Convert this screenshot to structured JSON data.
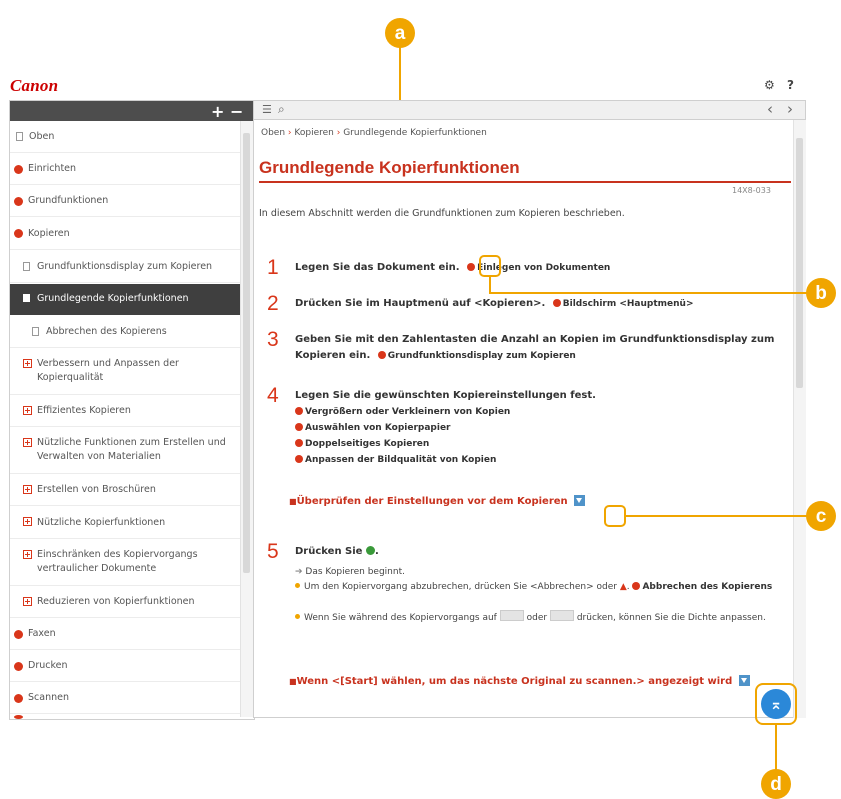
{
  "callouts": [
    "a",
    "b",
    "c",
    "d"
  ],
  "header": {
    "logo": "Canon",
    "gear_icon": "⚙",
    "help_label": "?"
  },
  "sidebar": {
    "expand_all": "+",
    "collapse_all": "−",
    "items": [
      {
        "label": "Oben",
        "icon": "doc-icon"
      },
      {
        "label": "Einrichten",
        "icon": "red-circle-icon"
      },
      {
        "label": "Grundfunktionen",
        "icon": "red-circle-icon"
      },
      {
        "label": "Kopieren",
        "icon": "red-circle-icon"
      },
      {
        "label": "Grundfunktionsdisplay zum Kopieren",
        "icon": "doc-icon"
      },
      {
        "label": "Grundlegende Kopierfunktionen",
        "icon": "doc-icon",
        "active": true
      },
      {
        "label": "Abbrechen des Kopierens",
        "icon": "doc-icon"
      },
      {
        "label": "Verbessern und Anpassen der Kopierqualität",
        "icon": "plus-icon"
      },
      {
        "label": "Effizientes Kopieren",
        "icon": "plus-icon"
      },
      {
        "label": "Nützliche Funktionen zum Erstellen und Verwalten von Materialien",
        "icon": "plus-icon"
      },
      {
        "label": "Erstellen von Broschüren",
        "icon": "plus-icon"
      },
      {
        "label": "Nützliche Kopierfunktionen",
        "icon": "plus-icon"
      },
      {
        "label": "Einschränken des Kopiervorgangs vertraulicher Dokumente",
        "icon": "plus-icon"
      },
      {
        "label": "Reduzieren von Kopierfunktionen",
        "icon": "plus-icon"
      },
      {
        "label": "Faxen",
        "icon": "red-circle-icon"
      },
      {
        "label": "Drucken",
        "icon": "red-circle-icon"
      },
      {
        "label": "Scannen",
        "icon": "red-circle-icon"
      }
    ]
  },
  "toolbar": {
    "toc_icon": "☰",
    "search_icon": "⌕",
    "prev": "‹",
    "next": "›"
  },
  "breadcrumb": [
    "Oben",
    "Kopieren",
    "Grundlegende Kopierfunktionen"
  ],
  "page": {
    "title": "Grundlegende Kopierfunktionen",
    "doc_id": "14X8-033",
    "intro": "In diesem Abschnitt werden die Grundfunktionen zum Kopieren beschrieben.",
    "steps": [
      {
        "num": "1",
        "text": "Legen Sie das Dokument ein.",
        "links": [
          "Einlegen von Dokumenten"
        ]
      },
      {
        "num": "2",
        "text": "Drücken Sie im Hauptmenü auf <Kopieren>.",
        "links": [
          "Bildschirm <Hauptmenü>"
        ]
      },
      {
        "num": "3",
        "text": "Geben Sie mit den Zahlentasten die Anzahl an Kopien im Grundfunktionsdisplay zum Kopieren ein.",
        "links": [
          "Grundfunktionsdisplay zum Kopieren"
        ]
      },
      {
        "num": "4",
        "text": "Legen Sie die gewünschten Kopiereinstellungen fest.",
        "links": [
          "Vergrößern oder Verkleinern von Kopien",
          "Auswählen von Kopierpapier",
          "Doppelseitiges Kopieren",
          "Anpassen der Bildqualität von Kopien"
        ]
      },
      {
        "num": "5",
        "text": "Drücken Sie",
        "links": []
      }
    ],
    "check_heading": "Überprüfen der Einstellungen vor dem Kopieren",
    "step5_result": "Das Kopieren beginnt.",
    "step5_note1_a": "Um den Kopiervorgang abzubrechen, drücken Sie <Abbrechen> oder",
    "step5_note1_link": "Abbrechen des Kopierens",
    "step5_note2_a": "Wenn Sie während des Kopiervorgangs auf",
    "step5_note2_b": "oder",
    "step5_note2_c": "drücken, können Sie die Dichte anpassen.",
    "next_heading": "Wenn <[Start] wählen, um das nächste Original zu scannen.> angezeigt wird"
  },
  "totop_icon": "⌅"
}
